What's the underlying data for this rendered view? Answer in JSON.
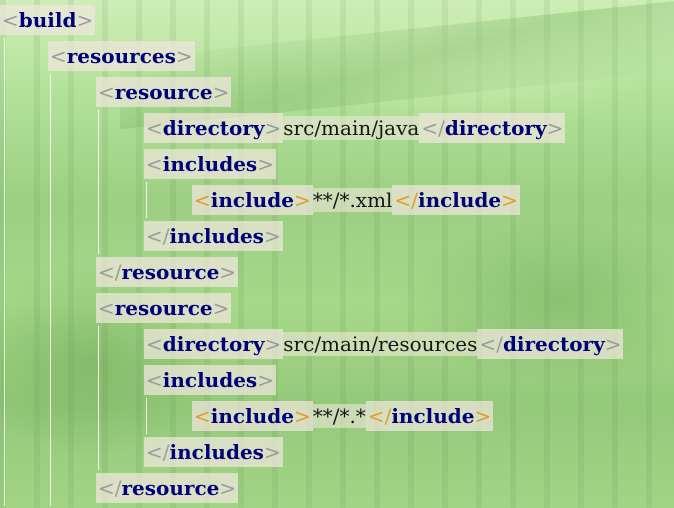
{
  "colors": {
    "tag_name": "#00007a",
    "bracket": "#9a9a9a",
    "bracket_highlight": "#e49a2a",
    "text": "#151515",
    "token_bg": "#f0e6dc"
  },
  "lines": [
    {
      "indent": 0,
      "type": "open",
      "tag": "build"
    },
    {
      "indent": 1,
      "type": "open",
      "tag": "resources"
    },
    {
      "indent": 2,
      "type": "open",
      "tag": "resource"
    },
    {
      "indent": 3,
      "type": "inline",
      "tag": "directory",
      "content": "src/main/java"
    },
    {
      "indent": 3,
      "type": "open",
      "tag": "includes"
    },
    {
      "indent": 4,
      "type": "inline",
      "tag": "include",
      "content": "**/*.xml",
      "highlight": true
    },
    {
      "indent": 3,
      "type": "close",
      "tag": "includes"
    },
    {
      "indent": 2,
      "type": "close",
      "tag": "resource"
    },
    {
      "indent": 2,
      "type": "open",
      "tag": "resource"
    },
    {
      "indent": 3,
      "type": "inline",
      "tag": "directory",
      "content": "src/main/resources"
    },
    {
      "indent": 3,
      "type": "open",
      "tag": "includes"
    },
    {
      "indent": 4,
      "type": "inline",
      "tag": "include",
      "content": "**/*.*",
      "highlight": true
    },
    {
      "indent": 3,
      "type": "close",
      "tag": "includes"
    },
    {
      "indent": 2,
      "type": "close",
      "tag": "resource"
    }
  ]
}
